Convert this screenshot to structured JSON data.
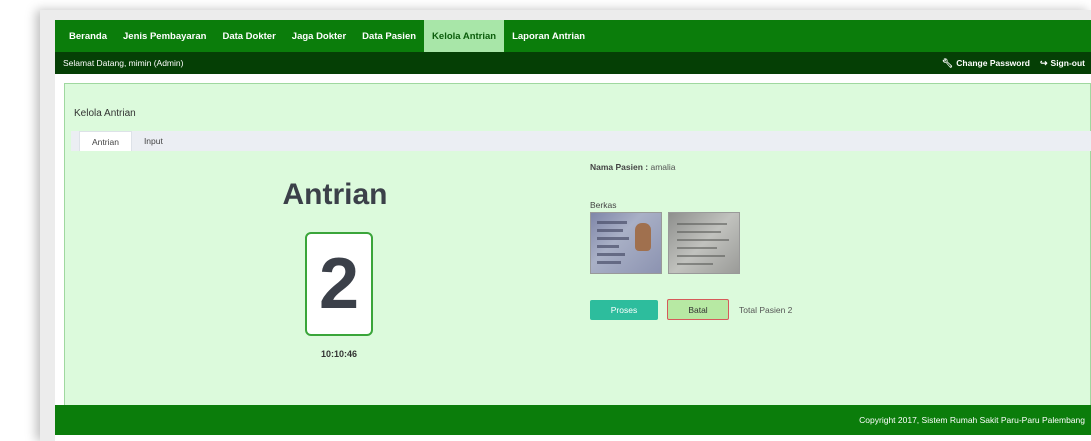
{
  "nav": {
    "items": [
      {
        "label": "Beranda",
        "active": false
      },
      {
        "label": "Jenis Pembayaran",
        "active": false
      },
      {
        "label": "Data Dokter",
        "active": false
      },
      {
        "label": "Jaga Dokter",
        "active": false
      },
      {
        "label": "Data Pasien",
        "active": false
      },
      {
        "label": "Kelola Antrian",
        "active": true
      },
      {
        "label": "Laporan Antrian",
        "active": false
      }
    ]
  },
  "subbar": {
    "welcome": "Selamat Datang, mimin (Admin)",
    "change_password": "Change Password",
    "change_password_icon": "wrench-icon",
    "sign_out": "Sign-out",
    "sign_out_icon": "sign-out-icon"
  },
  "panel": {
    "title": "Kelola Antrian",
    "tabs": [
      {
        "label": "Antrian",
        "active": true
      },
      {
        "label": "Input",
        "active": false
      }
    ]
  },
  "queue": {
    "heading": "Antrian",
    "number": "2",
    "time": "10:10:46"
  },
  "patient": {
    "label": "Nama Pasien :",
    "name": "amalia",
    "berkas_label": "Berkas",
    "files": [
      "id-card-photo",
      "document-photo"
    ]
  },
  "actions": {
    "proses_label": "Proses",
    "batal_label": "Batal",
    "total_pasien": "Total Pasien 2"
  },
  "footer": {
    "copyright": "Copyright 2017, Sistem Rumah Sakit Paru-Paru Palembang"
  },
  "colors": {
    "nav_bg": "#0b7d0b",
    "nav_active_bg": "#a8e6a8",
    "subbar_bg": "#053f05",
    "panel_bg": "#dcfadc",
    "proses_btn": "#2dbd9d",
    "batal_btn": "#b7e9a3"
  }
}
